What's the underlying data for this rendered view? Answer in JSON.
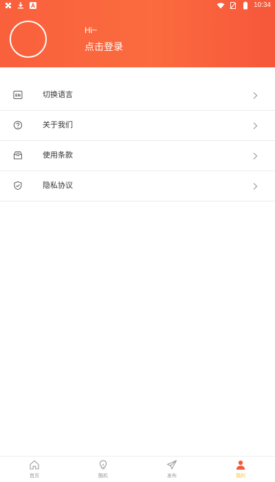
{
  "status_bar": {
    "time": "10:34",
    "left_icons": [
      "puzzle-app-icon",
      "download-icon",
      "translate-a-icon"
    ],
    "right_icons": [
      "wifi-icon",
      "no-sim-icon",
      "battery-icon"
    ]
  },
  "header": {
    "greeting": "Hi~",
    "login_label": "点击登录",
    "gradient_colors": [
      "#f9603c",
      "#fb6b3f",
      "#f6573a"
    ]
  },
  "menu": {
    "items": [
      {
        "label": "切换语言",
        "icon": "language-en-icon"
      },
      {
        "label": "关于我们",
        "icon": "question-icon"
      },
      {
        "label": "使用条款",
        "icon": "inbox-icon"
      },
      {
        "label": "隐私协议",
        "icon": "shield-check-icon"
      }
    ]
  },
  "tabbar": {
    "active_color": "#f7c23b",
    "inactive_color": "#999999",
    "tabs": [
      {
        "label": "首页",
        "icon": "home-icon",
        "active": false
      },
      {
        "label": "酷机",
        "icon": "bulb-icon",
        "active": false
      },
      {
        "label": "发布",
        "icon": "send-icon",
        "active": false
      },
      {
        "label": "我的",
        "icon": "person-icon",
        "active": true
      }
    ]
  }
}
